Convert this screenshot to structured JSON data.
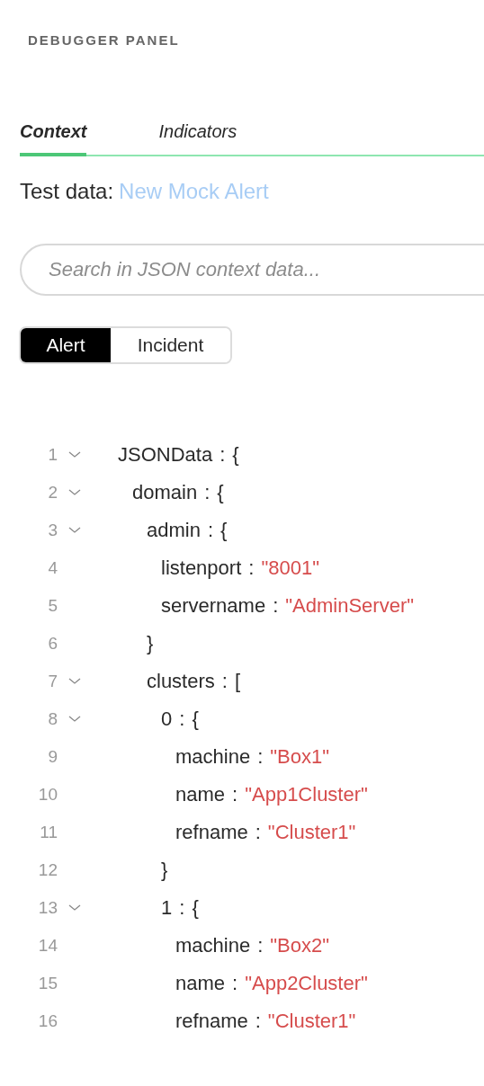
{
  "panel": {
    "title": "DEBUGGER PANEL"
  },
  "tabs": [
    {
      "label": "Context",
      "selected": true
    },
    {
      "label": "Indicators",
      "selected": false
    }
  ],
  "test_data": {
    "label": "Test data:",
    "link": "New Mock Alert"
  },
  "search": {
    "placeholder": "Search in JSON context data..."
  },
  "segments": [
    {
      "label": "Alert",
      "selected": true
    },
    {
      "label": "Incident",
      "selected": false
    }
  ],
  "tree": [
    {
      "line": "1",
      "key": "JSONData",
      "sep": ":",
      "open": "{",
      "expanded": true,
      "children": [
        {
          "line": "2",
          "key": "domain",
          "sep": ":",
          "open": "{",
          "expanded": true,
          "children": [
            {
              "line": "3",
              "key": "admin",
              "sep": ":",
              "open": "{",
              "expanded": true,
              "close_line": "6",
              "close": "}",
              "children": [
                {
                  "line": "4",
                  "key": "listenport",
                  "sep": ":",
                  "value": "\"8001\""
                },
                {
                  "line": "5",
                  "key": "servername",
                  "sep": ":",
                  "value": "\"AdminServer\""
                }
              ]
            },
            {
              "line": "7",
              "key": "clusters",
              "sep": ":",
              "open": "[",
              "expanded": true,
              "children": [
                {
                  "line": "8",
                  "key": "0",
                  "sep": ":",
                  "open": "{",
                  "expanded": true,
                  "close_line": "12",
                  "close": "}",
                  "children": [
                    {
                      "line": "9",
                      "key": "machine",
                      "sep": ":",
                      "value": "\"Box1\""
                    },
                    {
                      "line": "10",
                      "key": "name",
                      "sep": ":",
                      "value": "\"App1Cluster\""
                    },
                    {
                      "line": "11",
                      "key": "refname",
                      "sep": ":",
                      "value": "\"Cluster1\""
                    }
                  ]
                },
                {
                  "line": "13",
                  "key": "1",
                  "sep": ":",
                  "open": "{",
                  "expanded": true,
                  "children": [
                    {
                      "line": "14",
                      "key": "machine",
                      "sep": ":",
                      "value": "\"Box2\""
                    },
                    {
                      "line": "15",
                      "key": "name",
                      "sep": ":",
                      "value": "\"App2Cluster\""
                    },
                    {
                      "line": "16",
                      "key": "refname",
                      "sep": ":",
                      "value": "\"Cluster1\""
                    }
                  ]
                }
              ]
            }
          ]
        }
      ]
    }
  ]
}
